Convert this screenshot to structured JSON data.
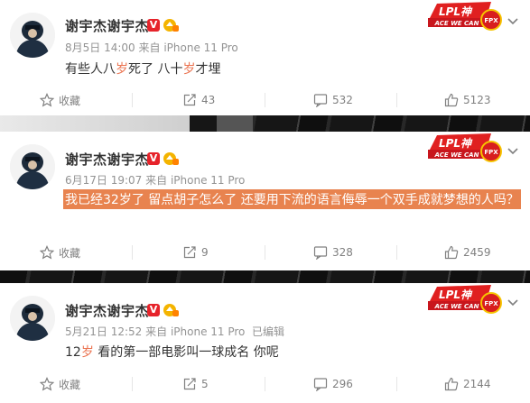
{
  "posts": [
    {
      "author": "谢宇杰谢宇杰",
      "verified": "V",
      "date": "8月5日 14:00",
      "source": "来自 iPhone 11 Pro",
      "edited": "",
      "content_parts": [
        "有些人八",
        "岁",
        "死了 八十",
        "岁",
        "才埋"
      ],
      "logo_text": "LPL神",
      "logo_sub": "ACE WE CAN",
      "logo_badge": "FPX",
      "actions": {
        "favorite": "收藏",
        "repost": "43",
        "comment": "532",
        "like": "5123"
      }
    },
    {
      "author": "谢宇杰谢宇杰",
      "verified": "V",
      "date": "6月17日 19:07",
      "source": "来自 iPhone 11 Pro",
      "edited": "",
      "content": "我已经32岁了 留点胡子怎么了 还要用下流的语言侮辱一个双手成就梦想的人吗？",
      "logo_text": "LPL神",
      "logo_sub": "ACE WE CAN",
      "logo_badge": "FPX",
      "actions": {
        "favorite": "收藏",
        "repost": "9",
        "comment": "328",
        "like": "2459"
      }
    },
    {
      "author": "谢宇杰谢宇杰",
      "verified": "V",
      "date": "5月21日 12:52",
      "source": "来自 iPhone 11 Pro",
      "edited": "已编辑",
      "content_parts": [
        "12",
        "岁",
        " 看的第一部电影叫一球成名 你呢"
      ],
      "logo_text": "LPL神",
      "logo_sub": "ACE WE CAN",
      "logo_badge": "FPX",
      "actions": {
        "favorite": "收藏",
        "repost": "5",
        "comment": "296",
        "like": "2144"
      }
    }
  ],
  "colors": {
    "highlight": "#eb7350",
    "selection": "#e8834f",
    "verified": "#e6232a",
    "text": "#333333",
    "meta": "#939393"
  }
}
